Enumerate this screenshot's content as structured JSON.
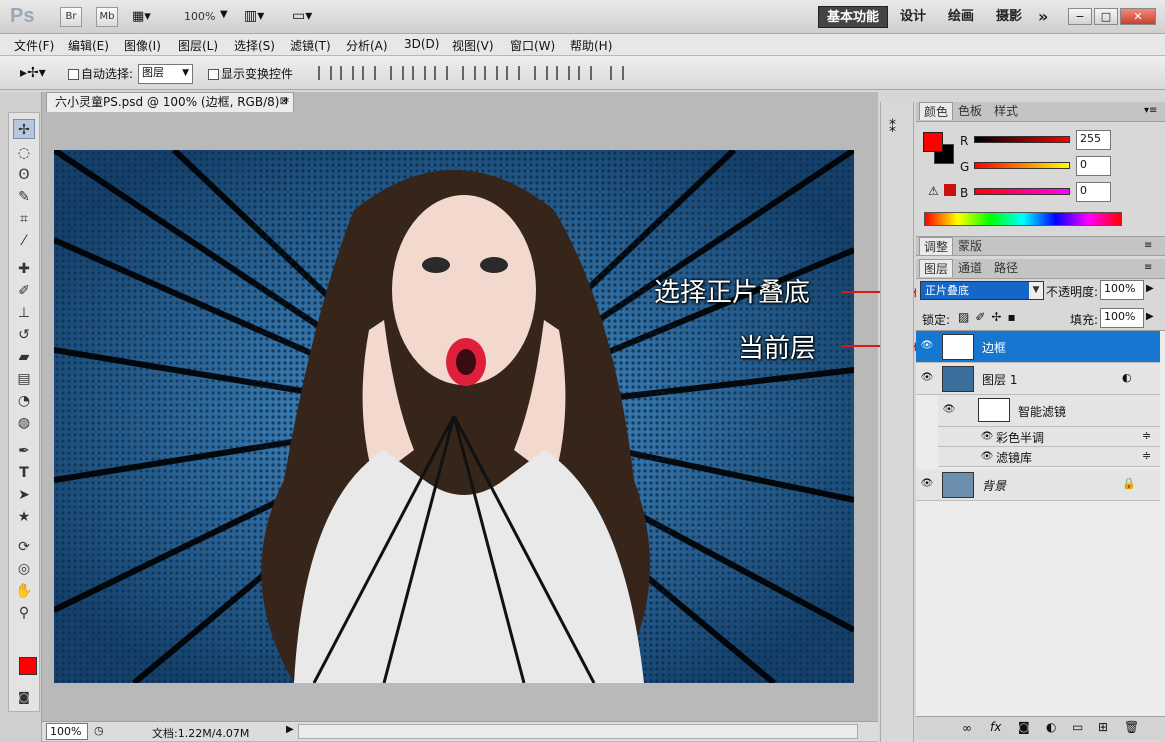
{
  "app": {
    "logo": "Ps",
    "bridge": "Br",
    "minibridge": "Mb",
    "zoom": "100%",
    "workspaces": [
      "基本功能",
      "设计",
      "绘画",
      "摄影"
    ],
    "more": "»"
  },
  "menu": [
    "文件(F)",
    "编辑(E)",
    "图像(I)",
    "图层(L)",
    "选择(S)",
    "滤镜(T)",
    "分析(A)",
    "3D(D)",
    "视图(V)",
    "窗口(W)",
    "帮助(H)"
  ],
  "options": {
    "auto_select_label": "自动选择:",
    "auto_select_value": "图层",
    "show_transform_label": "显示变换控件"
  },
  "document": {
    "tab_title": "六小灵童PS.psd @ 100% (边框, RGB/8) *",
    "status_zoom": "100%",
    "status_doc": "文档:1.22M/4.07M"
  },
  "color_panel": {
    "tabs": [
      "颜色",
      "色板",
      "样式"
    ],
    "r_label": "R",
    "g_label": "G",
    "b_label": "B",
    "r": "255",
    "g": "0",
    "b": "0",
    "foreground": "#ff0000",
    "background": "#000000"
  },
  "adjust_panel": {
    "tabs": [
      "调整",
      "蒙版"
    ]
  },
  "layers_panel": {
    "tabs": [
      "图层",
      "通道",
      "路径"
    ],
    "blend_mode": "正片叠底",
    "opacity_label": "不透明度:",
    "opacity": "100%",
    "lock_label": "锁定:",
    "fill_label": "填充:",
    "fill": "100%",
    "layers": [
      {
        "name": "边框",
        "selected": true
      },
      {
        "name": "图层 1",
        "selected": false
      },
      {
        "name": "智能滤镜",
        "selected": false
      },
      {
        "name": "彩色半调",
        "selected": false
      },
      {
        "name": "滤镜库",
        "selected": false
      },
      {
        "name": "背景",
        "selected": false
      }
    ]
  },
  "annotations": {
    "blend": "选择正片叠底",
    "current": "当前层"
  }
}
